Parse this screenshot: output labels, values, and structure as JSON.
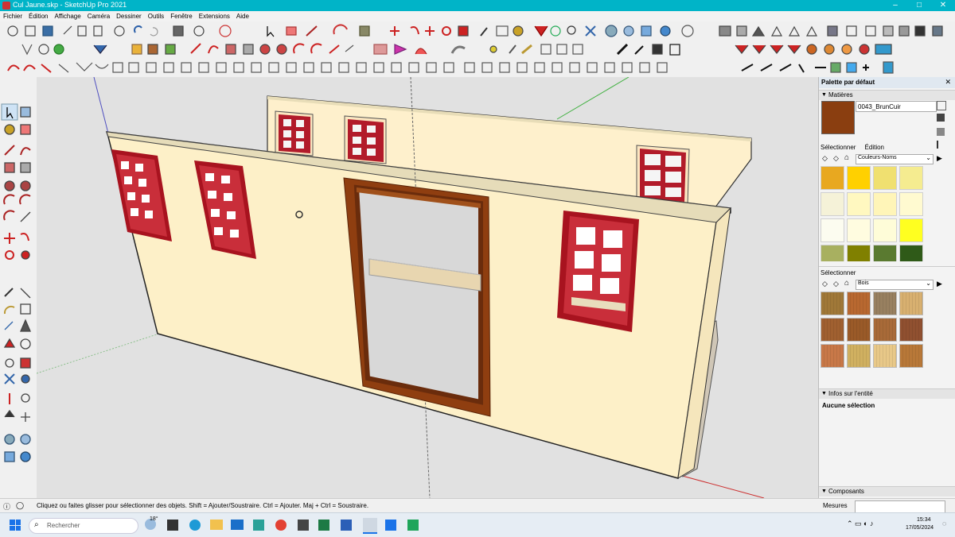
{
  "window": {
    "title": "Cul Jaune.skp - SketchUp Pro 2021",
    "controls": [
      "–",
      "□",
      "✕"
    ]
  },
  "menu": [
    "Fichier",
    "Édition",
    "Affichage",
    "Caméra",
    "Dessiner",
    "Outils",
    "Fenêtre",
    "Extensions",
    "Aide"
  ],
  "tray": {
    "title": "Palette par défaut",
    "materials": {
      "header": "Matières",
      "current_name": "0043_BrunCuir",
      "current_color": "#8a3e10",
      "tabs": [
        "Sélectionner",
        "Édition"
      ],
      "library": "Couleurs-Noms",
      "colors": [
        "#e8a820",
        "#ffd000",
        "#f0e070",
        "#f5ec90",
        "#f5f2d8",
        "#fff8c0",
        "#fff5b8",
        "#fffad0",
        "#fcfcf0",
        "#fffce0",
        "#fefcd8",
        "#ffff20",
        "#a8b060",
        "#808000",
        "#5a7a30",
        "#2f5a18",
        "#a0c040",
        "#9acd32",
        "#90c040",
        "#80c020"
      ]
    },
    "secondary": {
      "header": "Sélectionner",
      "library": "Bois",
      "textures": [
        "#a07838",
        "#b86830",
        "#988060",
        "#d8b070",
        "#a06030",
        "#9a5a28",
        "#a86a38",
        "#905030",
        "#c87848",
        "#d0b060",
        "#e8c888",
        "#b87838"
      ]
    },
    "entity_info": {
      "header": "Infos sur l'entité",
      "text": "Aucune sélection"
    },
    "components": {
      "header": "Composants"
    }
  },
  "status": {
    "hint": "Cliquez ou faites glisser pour sélectionner des objets. Shift = Ajouter/Soustraire. Ctrl = Ajouter. Maj + Ctrl = Soustraire.",
    "measurements_label": "Mesures"
  },
  "taskbar": {
    "search_placeholder": "Rechercher",
    "temperature": "18°",
    "time": "15:34",
    "date": "17/05/2024"
  }
}
